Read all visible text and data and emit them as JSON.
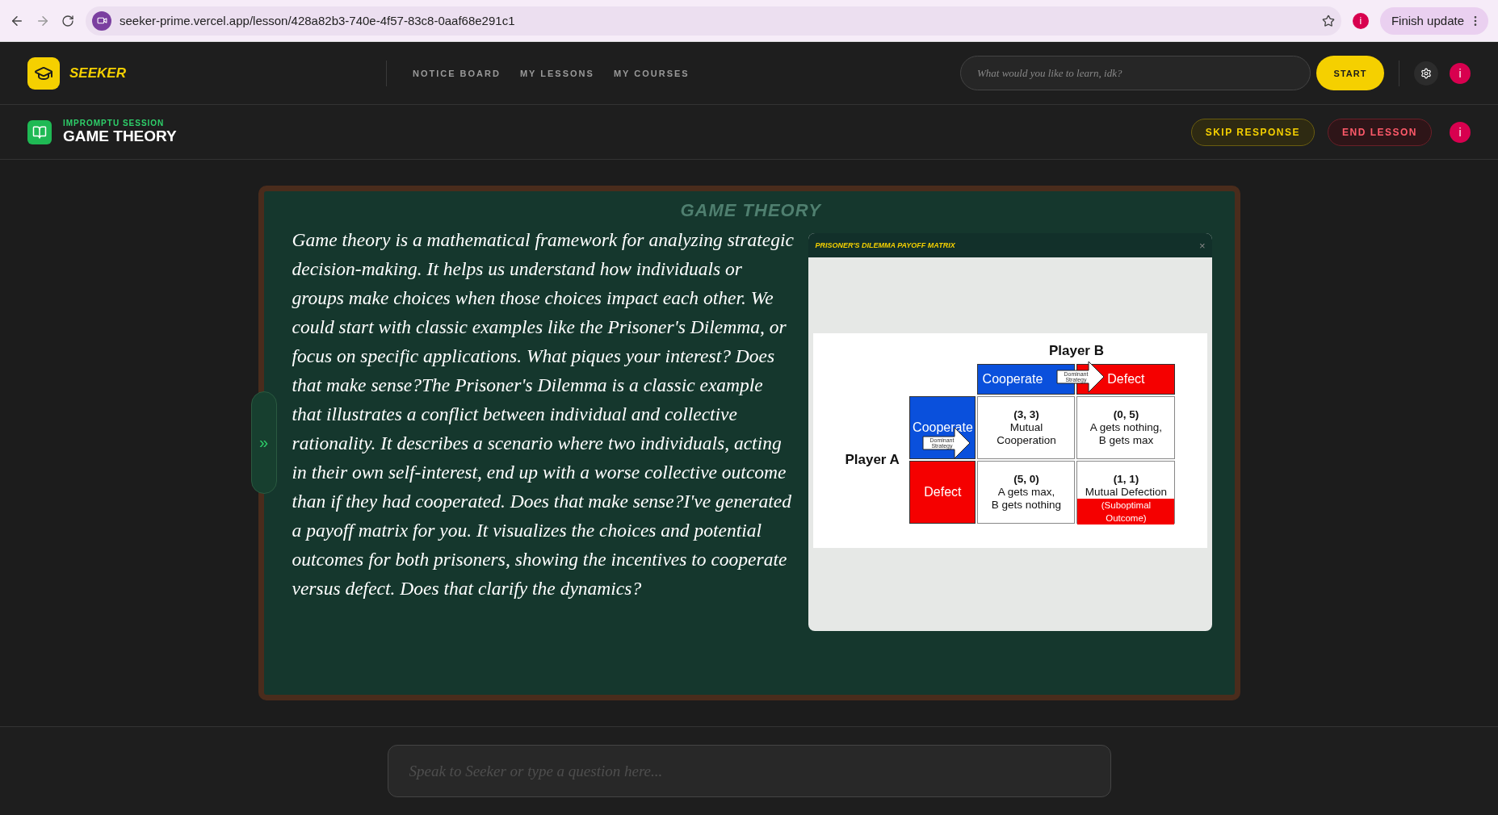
{
  "browser": {
    "url": "seeker-prime.vercel.app/lesson/428a82b3-740e-4f57-83c8-0aaf68e291c1",
    "profile": "i",
    "update_button": "Finish update"
  },
  "header": {
    "logo": "SEEKER",
    "nav": [
      {
        "label": "NOTICE BOARD",
        "selected": false
      },
      {
        "label": "MY LESSONS",
        "selected": false
      },
      {
        "label": "MY COURSES",
        "selected": false
      }
    ],
    "search": {
      "placeholder": "What would you like to learn, idk?"
    },
    "start_button": "START",
    "profile": "i"
  },
  "lesson": {
    "session_label": "IMPROMPTU SESSION",
    "title": "GAME THEORY",
    "buttons": [
      {
        "label": "SKIP RESPONSE",
        "kind": "skip"
      },
      {
        "label": "END LESSON",
        "kind": "end"
      }
    ],
    "profile": "i"
  },
  "board": {
    "watermark": "GAME THEORY",
    "toggle": "»",
    "text": "Game theory is a mathematical framework for analyzing strategic decision-making. It helps us understand how individuals or groups make choices when those choices impact each other. We could start with classic examples like the Prisoner's Dilemma, or focus on specific applications. What piques your interest? Does that make sense?The Prisoner's Dilemma is a classic example that illustrates a conflict between individual and collective rationality. It describes a scenario where two individuals, acting in their own self-interest, end up with a worse collective outcome than if they had cooperated. Does that make sense?I've generated a payoff matrix for you. It visualizes the choices and potential outcomes for both prisoners, showing the incentives to cooperate versus defect. Does that clarify the dynamics?",
    "panel": {
      "title": "PRISONER'S DILEMMA PAYOFF MATRIX",
      "close": "×",
      "matrix": {
        "player_b": "Player B",
        "player_a": "Player A",
        "columns": [
          {
            "label": "Cooperate",
            "color": "#0a50dc"
          },
          {
            "label": "Defect",
            "color": "#f50000"
          }
        ],
        "rows": [
          {
            "label": "Cooperate",
            "color": "#0a50dc"
          },
          {
            "label": "Defect",
            "color": "#f50000"
          }
        ],
        "arrows": [
          "Dominant Strategy",
          "Dominant Strategy"
        ],
        "cells": [
          {
            "payoff": "(3, 3)",
            "lines": [
              "Mutual",
              "Cooperation"
            ]
          },
          {
            "payoff": "(0, 5)",
            "lines": [
              "A gets nothing,",
              "B gets max"
            ]
          },
          {
            "payoff": "(5, 0)",
            "lines": [
              "A gets max,",
              "B gets nothing"
            ]
          },
          {
            "payoff": "(1, 1)",
            "lines": [
              "Mutual Defection"
            ],
            "note": "(Suboptimal Outcome)"
          }
        ]
      }
    }
  },
  "composer": {
    "placeholder": "Speak to Seeker or type a question here..."
  }
}
